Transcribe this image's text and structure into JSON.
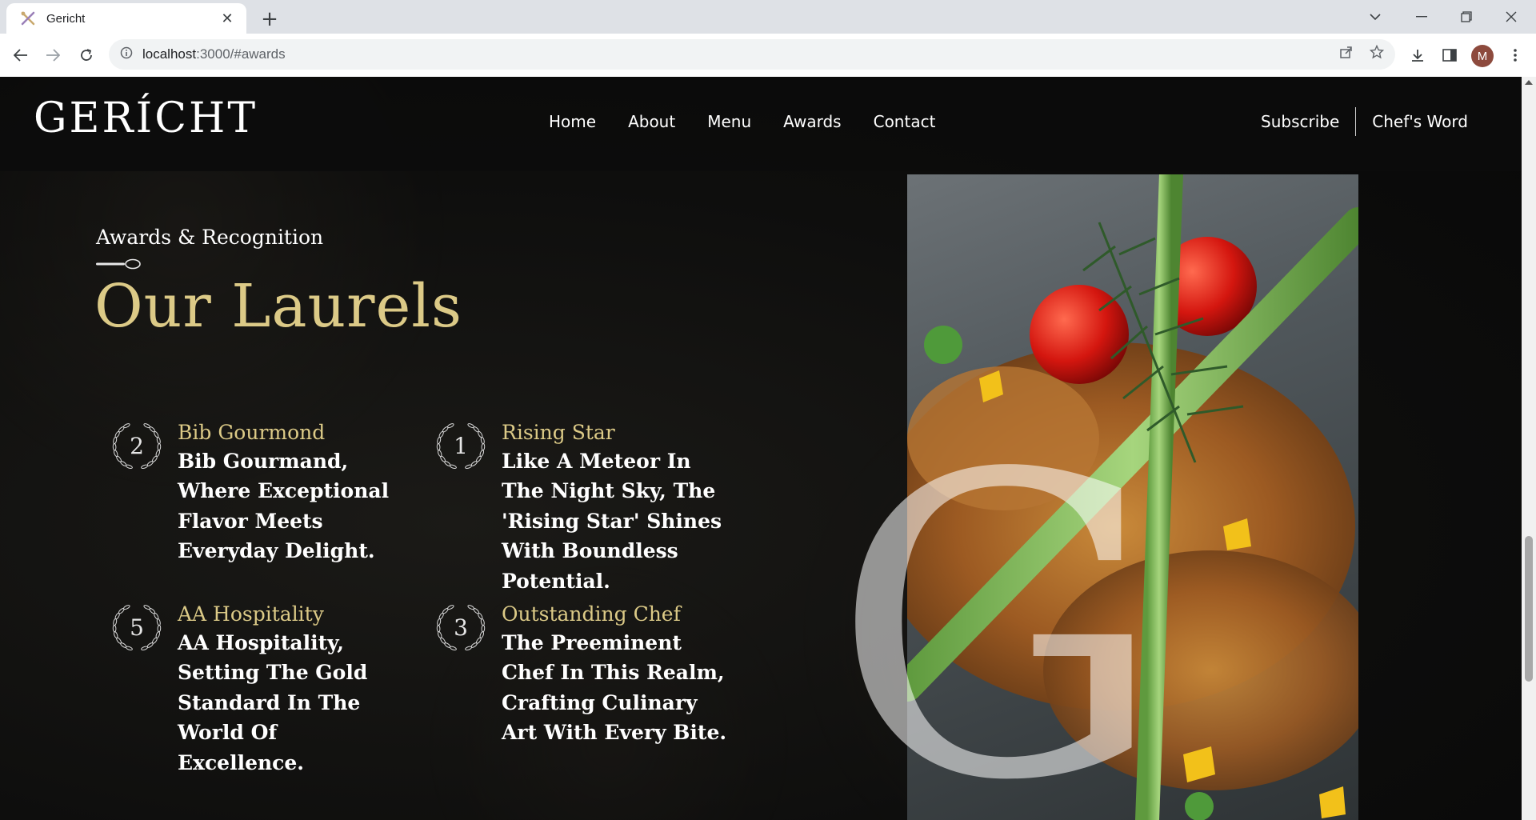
{
  "browser": {
    "tab_title": "Gericht",
    "tab_close": "✕",
    "new_tab": "+",
    "url_host": "localhost",
    "url_path": ":3000/#awards",
    "profile_initial": "M",
    "win_minimize": "—",
    "win_restore": "❐",
    "win_close": "✕",
    "tab_search": "⌄"
  },
  "navbar": {
    "logo": "GERÍCHT",
    "links": [
      "Home",
      "About",
      "Menu",
      "Awards",
      "Contact"
    ],
    "subscribe": "Subscribe",
    "chefs_word": "Chef's Word"
  },
  "section": {
    "subtitle": "Awards & Recognition",
    "headline": "Our Laurels",
    "watermark": "G"
  },
  "awards": [
    {
      "number": "2",
      "title": "Bib Gourmond",
      "desc": "Bib Gourmand, Where Exceptional Flavor Meets Everyday Delight."
    },
    {
      "number": "1",
      "title": "Rising Star",
      "desc": "Like A Meteor In The Night Sky, The 'Rising Star' Shines With Boundless Potential."
    },
    {
      "number": "5",
      "title": "AA Hospitality",
      "desc": "AA Hospitality, Setting The Gold Standard In The World Of Excellence."
    },
    {
      "number": "3",
      "title": "Outstanding Chef",
      "desc": "The Preeminent Chef In This Realm, Crafting Culinary Art With Every Bite."
    }
  ],
  "colors": {
    "gold": "#dcca87",
    "background": "#0c0c0c",
    "text": "#ffffff"
  }
}
